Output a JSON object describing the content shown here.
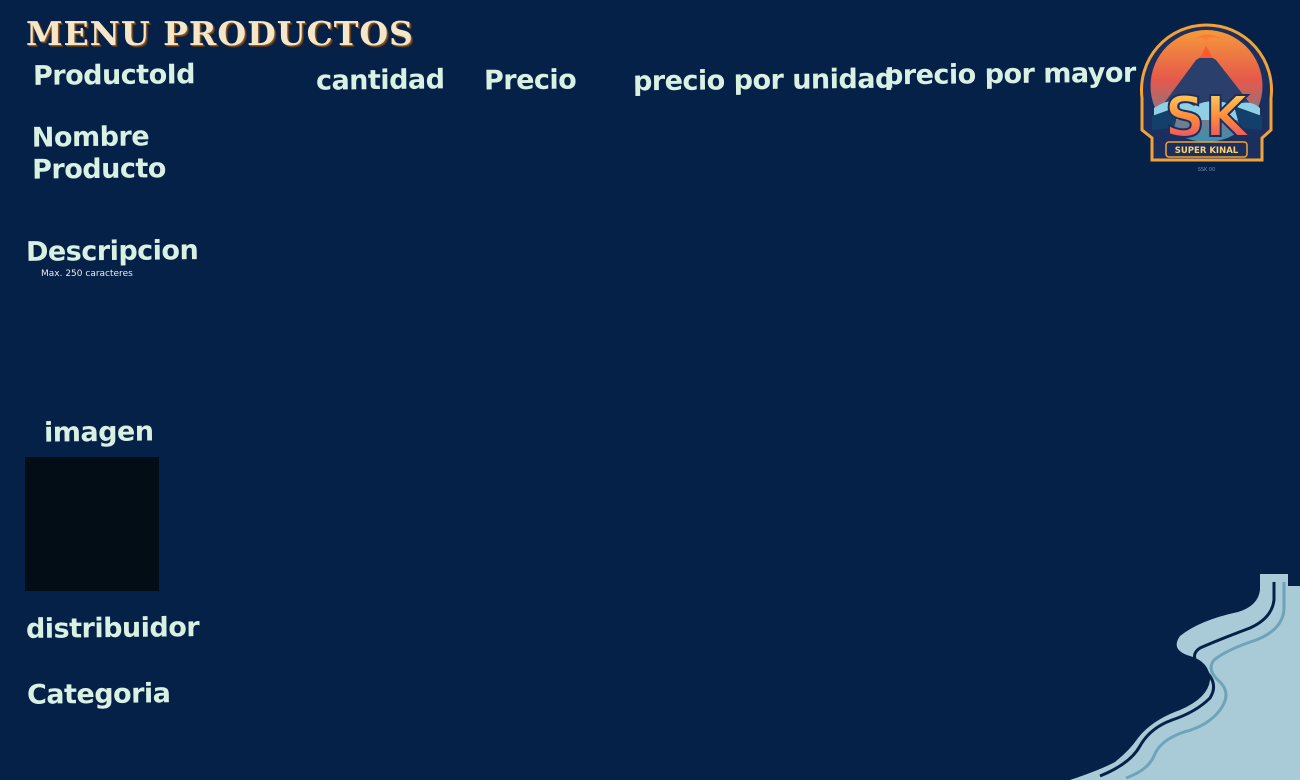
{
  "header": {
    "title": "MENU PRODUCTOS"
  },
  "form": {
    "producto_id_label": "ProductoId",
    "cantidad_label": "cantidad",
    "precio_label": "Precio",
    "precio_unidad_label": "precio por unidad",
    "precio_mayor_label": "precio por mayor",
    "nombre_label_line1": "Nombre",
    "nombre_label_line2": "Producto",
    "descripcion_label": "Descripcion",
    "descripcion_hint": "Max. 250 caracteres",
    "imagen_label": "imagen",
    "distribuidor_label": "distribuidor",
    "categoria_label": "Categoria"
  },
  "logo": {
    "initials": "SK",
    "name": "SUPER KINAL",
    "tagline": "SSK 00"
  },
  "colors": {
    "background": "#052148",
    "label_text": "#d9f1e3",
    "title_text": "#f4e6c9",
    "image_placeholder": "#020d15",
    "decor_fill": "#a9cbd8"
  }
}
